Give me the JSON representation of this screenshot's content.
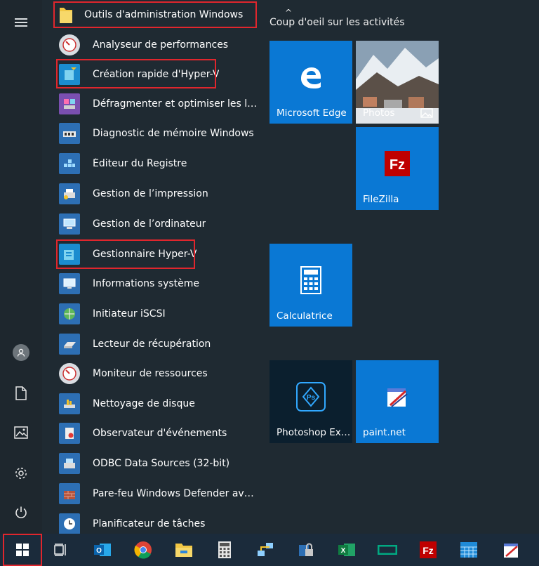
{
  "start_menu": {
    "folder": {
      "label": "Outils d'administration Windows",
      "chevron": "^"
    },
    "group_title": "Coup d'oeil sur les activités",
    "apps": [
      {
        "label": "Analyseur de performances",
        "icon": "performance-gauge-icon"
      },
      {
        "label": "Création rapide d'Hyper-V",
        "icon": "hyper-v-quick-create-icon"
      },
      {
        "label": "Défragmenter et optimiser les lect…",
        "icon": "defragment-icon"
      },
      {
        "label": "Diagnostic de mémoire Windows",
        "icon": "memory-diagnostic-icon"
      },
      {
        "label": "Éditeur du Registre",
        "icon": "registry-editor-icon"
      },
      {
        "label": "Gestion de l’impression",
        "icon": "print-management-icon"
      },
      {
        "label": "Gestion de l’ordinateur",
        "icon": "computer-management-icon"
      },
      {
        "label": "Gestionnaire Hyper-V",
        "icon": "hyper-v-manager-icon"
      },
      {
        "label": "Informations système",
        "icon": "system-information-icon"
      },
      {
        "label": "Initiateur iSCSI",
        "icon": "iscsi-initiator-icon"
      },
      {
        "label": "Lecteur de récupération",
        "icon": "recovery-drive-icon"
      },
      {
        "label": "Moniteur de ressources",
        "icon": "resource-monitor-icon"
      },
      {
        "label": "Nettoyage de disque",
        "icon": "disk-cleanup-icon"
      },
      {
        "label": "Observateur d'événements",
        "icon": "event-viewer-icon"
      },
      {
        "label": "ODBC Data Sources (32-bit)",
        "icon": "odbc-icon"
      },
      {
        "label": "Pare-feu Windows Defender avec f…",
        "icon": "firewall-icon"
      },
      {
        "label": "Planificateur de tâches",
        "icon": "task-scheduler-icon"
      }
    ],
    "tiles": {
      "edge": {
        "label": "Microsoft Edge",
        "color": "#0a78d4"
      },
      "photos": {
        "label": "Photos"
      },
      "filezilla": {
        "label": "FileZilla",
        "color": "#0a78d4"
      },
      "calculator": {
        "label": "Calculatrice",
        "color": "#0a78d4"
      },
      "photoshop": {
        "label": "Photoshop Ex…",
        "color": "#0b1f2e"
      },
      "paintnet": {
        "label": "paint.net",
        "color": "#0a78d4"
      }
    }
  },
  "taskbar": {
    "items": [
      "windows-start-icon",
      "task-view-icon",
      "outlook-icon",
      "chrome-icon",
      "file-explorer-icon",
      "calculator-icon",
      "network-icon",
      "security-icon",
      "excel-icon",
      "hpe-icon",
      "filezilla-icon",
      "calendar-app-icon",
      "paintnet-icon"
    ]
  },
  "colors": {
    "highlight": "#e0262d",
    "tile_blue": "#0a78d4",
    "background": "#1f2a32"
  }
}
